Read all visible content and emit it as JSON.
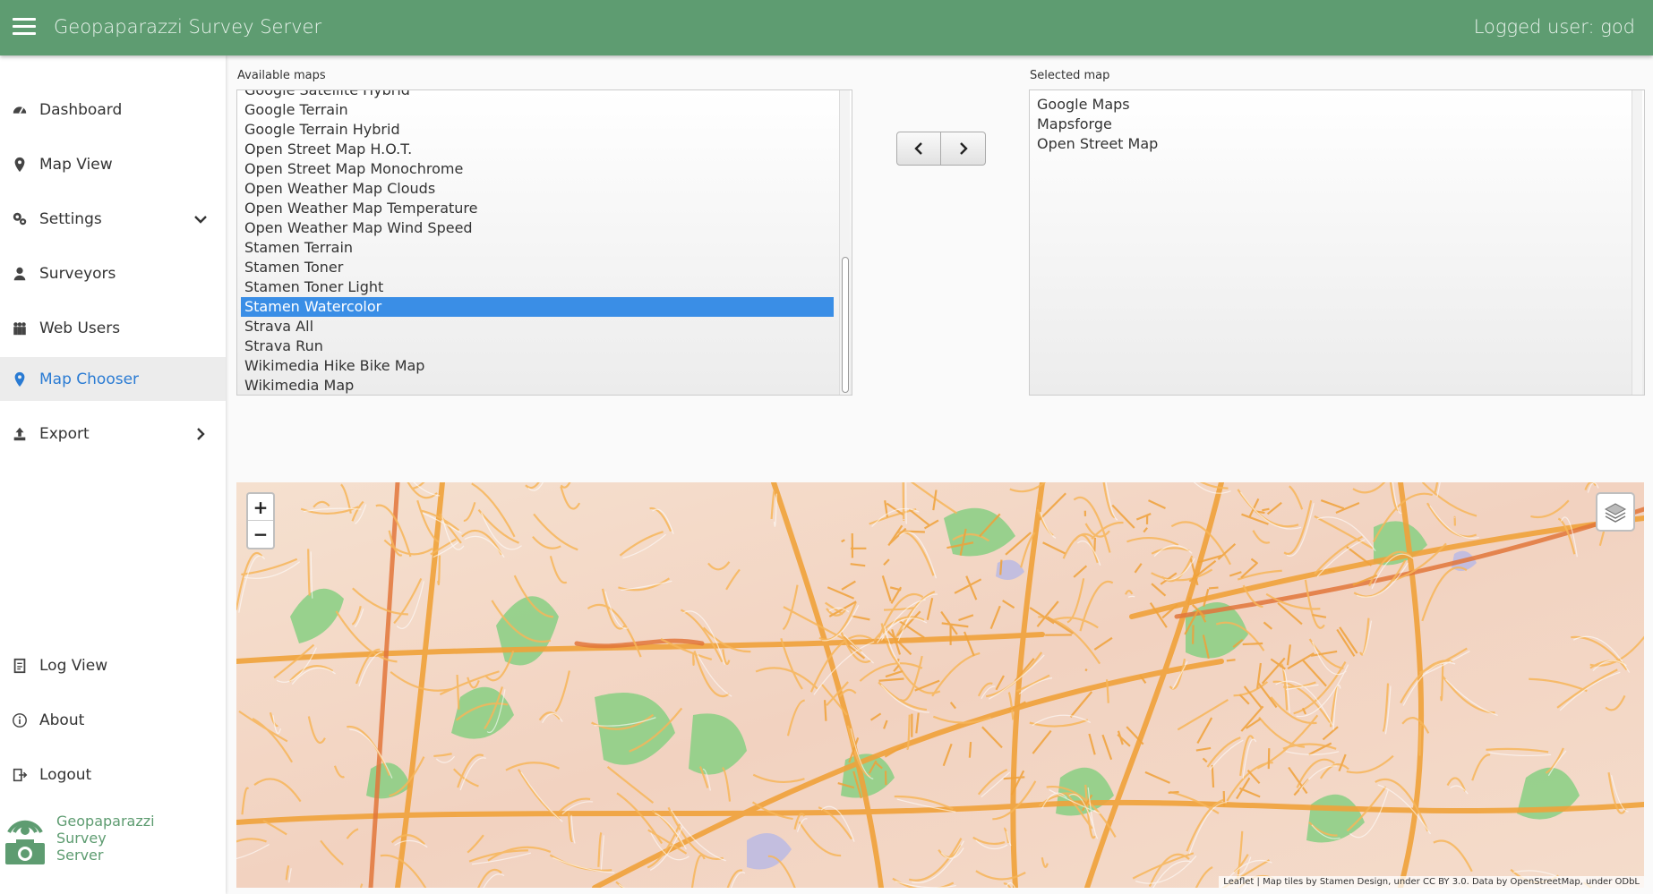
{
  "header": {
    "title": "Geopaparazzi Survey Server",
    "logged_user": "Logged user: god"
  },
  "sidebar": {
    "items": [
      {
        "label": "Dashboard",
        "icon": "dashboard-icon"
      },
      {
        "label": "Map View",
        "icon": "map-pin-icon"
      },
      {
        "label": "Settings",
        "icon": "gears-icon"
      },
      {
        "label": "Surveyors",
        "icon": "surveyor-icon"
      },
      {
        "label": "Web Users",
        "icon": "users-icon"
      },
      {
        "label": "Map Chooser",
        "icon": "map-pin-icon"
      },
      {
        "label": "Export",
        "icon": "export-icon"
      },
      {
        "label": "Log View",
        "icon": "log-icon"
      },
      {
        "label": "About",
        "icon": "info-icon"
      },
      {
        "label": "Logout",
        "icon": "logout-icon"
      }
    ],
    "active": "Map Chooser",
    "brand": {
      "line1": "Geopaparazzi",
      "line2": "Survey",
      "line3": "Server"
    }
  },
  "available": {
    "label": "Available maps",
    "items": [
      "Google Satellite Hybrid",
      "Google Terrain",
      "Google Terrain Hybrid",
      "Open Street Map H.O.T.",
      "Open Street Map Monochrome",
      "Open Weather Map Clouds",
      "Open Weather Map Temperature",
      "Open Weather Map Wind Speed",
      "Stamen Terrain",
      "Stamen Toner",
      "Stamen Toner Light",
      "Stamen Watercolor",
      "Strava All",
      "Strava Run",
      "Wikimedia Hike Bike Map",
      "Wikimedia Map"
    ],
    "selected": "Stamen Watercolor"
  },
  "selected_map": {
    "label": "Selected map",
    "items": [
      "Google Maps",
      "Mapsforge",
      "Open Street Map"
    ]
  },
  "map": {
    "zoom_in": "+",
    "zoom_out": "−",
    "attribution": "Leaflet | Map tiles by Stamen Design, under CC BY 3.0. Data by OpenStreetMap, under ODbL"
  },
  "colors": {
    "header": "#5e9c71",
    "active_link": "#2a7bd3",
    "selection": "#3a8ee6"
  }
}
